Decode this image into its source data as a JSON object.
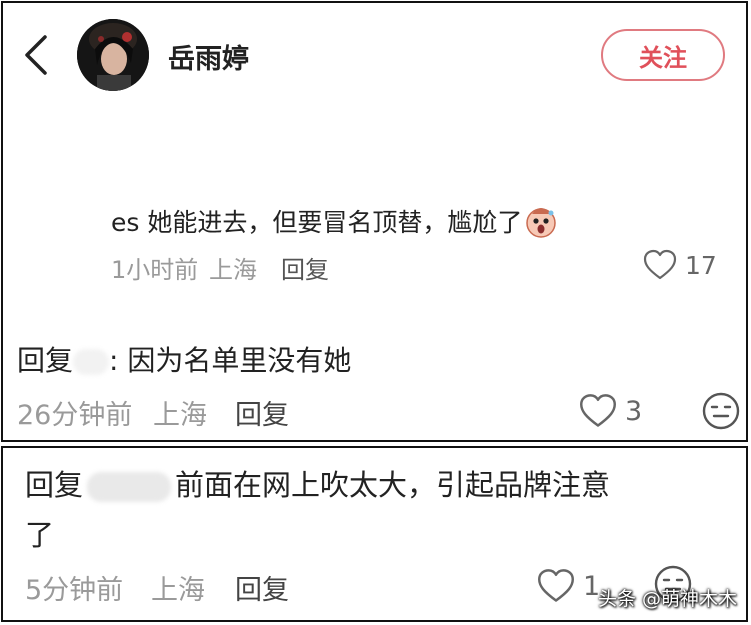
{
  "header": {
    "username": "岳雨婷",
    "follow_label": "关注",
    "icons": {
      "back": "back-chevron-icon",
      "avatar": "user-avatar"
    }
  },
  "comment": {
    "text": "es 她能进去，但要冒名顶替，尴尬了",
    "emoji": "shocked-face-emoji",
    "time": "1小时前",
    "location": "上海",
    "reply_label": "回复",
    "likes": "17"
  },
  "replies": [
    {
      "prefix": "回复",
      "text": ": 因为名单里没有她",
      "time": "26分钟前",
      "location": "上海",
      "reply_label": "回复",
      "likes": "3"
    },
    {
      "prefix": "回复",
      "text_line1": "前面在网上吹太大，引起品牌注意",
      "text_line2": "了",
      "time": "5分钟前",
      "location": "上海",
      "reply_label": "回复",
      "likes": "1"
    }
  ],
  "watermark": "头条 @萌神木木",
  "colors": {
    "accent": "#e0505a",
    "border": "#111111",
    "meta": "#9a9a9a"
  }
}
